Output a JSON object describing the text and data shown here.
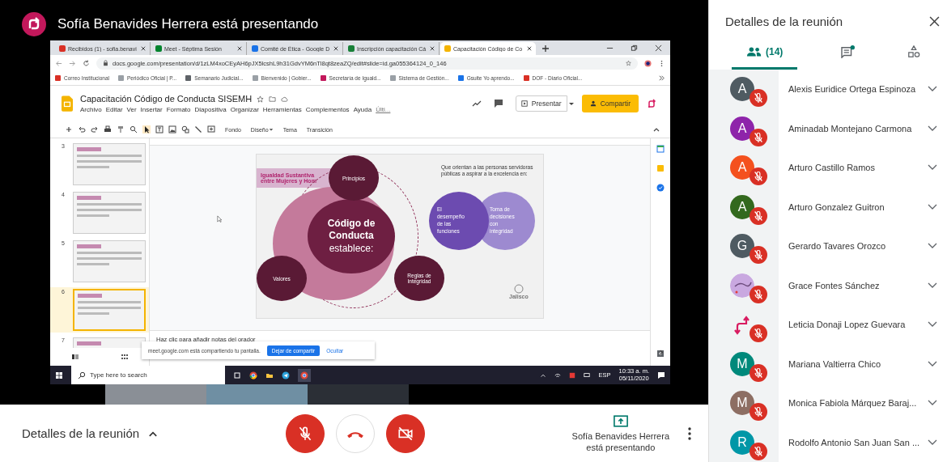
{
  "presenter_bar": {
    "title": "Sofía Benavides Herrera está presentando"
  },
  "shared_screen": {
    "browser_tabs": [
      {
        "label": "Recibidos (1) - sofia.benavi",
        "kind": "mail",
        "selected": false
      },
      {
        "label": "Meet - Séptima Sesión",
        "kind": "meet",
        "selected": false
      },
      {
        "label": "Comité de Ética - Google D",
        "kind": "drive",
        "selected": false
      },
      {
        "label": "Inscripción capacitación Cá",
        "kind": "sheets",
        "selected": false
      },
      {
        "label": "Capacitación Código de Co",
        "kind": "slides",
        "selected": true
      }
    ],
    "url": "docs.google.com/presentation/d/1zLM4xoCEyAH6pJX5lcshL9h31GdvYM6nTl8qt8zeaZQ/edit#slide=id.ga055364124_0_146",
    "bookmarks": [
      {
        "label": "Correo Institucional",
        "kind": "mail"
      },
      {
        "label": "Periódico Oficial | P...",
        "kind": "page"
      },
      {
        "label": "Semanario Judicial...",
        "kind": "globe"
      },
      {
        "label": "Bienvenido | Gobier...",
        "kind": "page"
      },
      {
        "label": "Secretaría de Iguald...",
        "kind": "arrow"
      },
      {
        "label": "Sistema de Gestión...",
        "kind": "page"
      },
      {
        "label": "Gsuite Yo aprendo...",
        "kind": "x"
      },
      {
        "label": "DOF - Diario Oficial...",
        "kind": "dof"
      }
    ],
    "doc_title": "Capacitación Código de Conducta SISEMH",
    "menu": [
      "Archivo",
      "Editar",
      "Ver",
      "Insertar",
      "Formato",
      "Diapositiva",
      "Organizar",
      "Herramientas",
      "Complementos",
      "Ayuda",
      "Últi..."
    ],
    "present_button": "Presentar",
    "share_button": "Compartir",
    "toolbar_labels": [
      "Fondo",
      "Diseño",
      "Tema",
      "Transición"
    ],
    "thumbnails": [
      {
        "number": "3",
        "selected": false
      },
      {
        "number": "4",
        "selected": false
      },
      {
        "number": "5",
        "selected": false
      },
      {
        "number": "6",
        "selected": true
      },
      {
        "number": "7",
        "selected": false
      }
    ],
    "slide": {
      "banner": [
        "Igualdad Sustantiva",
        "entre Mujeres y Hom"
      ],
      "center_title": [
        "Código de",
        "Conducta"
      ],
      "center_subtitle": "establece:",
      "top_node": "Principios",
      "left_node": "Valores",
      "right_node": [
        "Reglas de",
        "Integridad"
      ],
      "intro": "Que orientan a las personas servidoras públicas a aspirar a la excelencia en:",
      "circle_left": [
        "El",
        "desempeño",
        "de las",
        "funciones"
      ],
      "circle_right": [
        "Toma de",
        "decisiones",
        "con",
        "integridad"
      ],
      "logo": "Jalisco"
    },
    "notes_placeholder": "Haz clic para añadir notas del orador",
    "share_notice": {
      "message": "meet.google.com está compartiendo tu pantalla.",
      "stop": "Dejar de compartir",
      "hide": "Ocultar"
    },
    "taskbar": {
      "search_placeholder": "Type here to search",
      "language": "ESP",
      "time": "10:33 a. m.",
      "date": "05/11/2020"
    }
  },
  "bottom_bar": {
    "details": "Detalles de la reunión",
    "mic_muted": true,
    "camera_off": true,
    "presenter_name": "Sofía Benavides Herrera",
    "presenter_status": "está presentando"
  },
  "side_panel": {
    "title": "Detalles de la reunión",
    "tabs": [
      {
        "kind": "people",
        "label": "(14)",
        "selected": true
      },
      {
        "kind": "chat",
        "unread": true,
        "selected": false
      },
      {
        "kind": "activities",
        "selected": false
      }
    ],
    "participants": [
      {
        "name": "Alexis Euridice Ortega Espinoza",
        "kind": "letter",
        "letter": "A",
        "color": "#4f5b62",
        "muted": true
      },
      {
        "name": "Aminadab Montejano Carmona",
        "kind": "letter",
        "letter": "A",
        "color": "#8e24aa",
        "muted": true
      },
      {
        "name": "Arturo Castillo Ramos",
        "kind": "letter",
        "letter": "A",
        "color": "#f4511e",
        "muted": true
      },
      {
        "name": "Arturo Gonzalez Guitron",
        "kind": "letter",
        "letter": "A",
        "color": "#33691e",
        "muted": true
      },
      {
        "name": "Gerardo Tavares Orozco",
        "kind": "letter",
        "letter": "G",
        "color": "#4f5b62",
        "muted": true
      },
      {
        "name": "Grace Fontes Sánchez",
        "kind": "image",
        "muted": true
      },
      {
        "name": "Leticia Donaji Lopez Guevara",
        "kind": "logo",
        "muted": true
      },
      {
        "name": "Mariana Valtierra Chico",
        "kind": "letter",
        "letter": "M",
        "color": "#00897b",
        "muted": true
      },
      {
        "name": "Monica Fabiola Márquez Baraj...",
        "kind": "letter",
        "letter": "M",
        "color": "#8d6e63",
        "muted": true
      },
      {
        "name": "Rodolfo Antonio San Juan San ...",
        "kind": "letter",
        "letter": "R",
        "color": "#0097a7",
        "muted": true
      }
    ]
  }
}
